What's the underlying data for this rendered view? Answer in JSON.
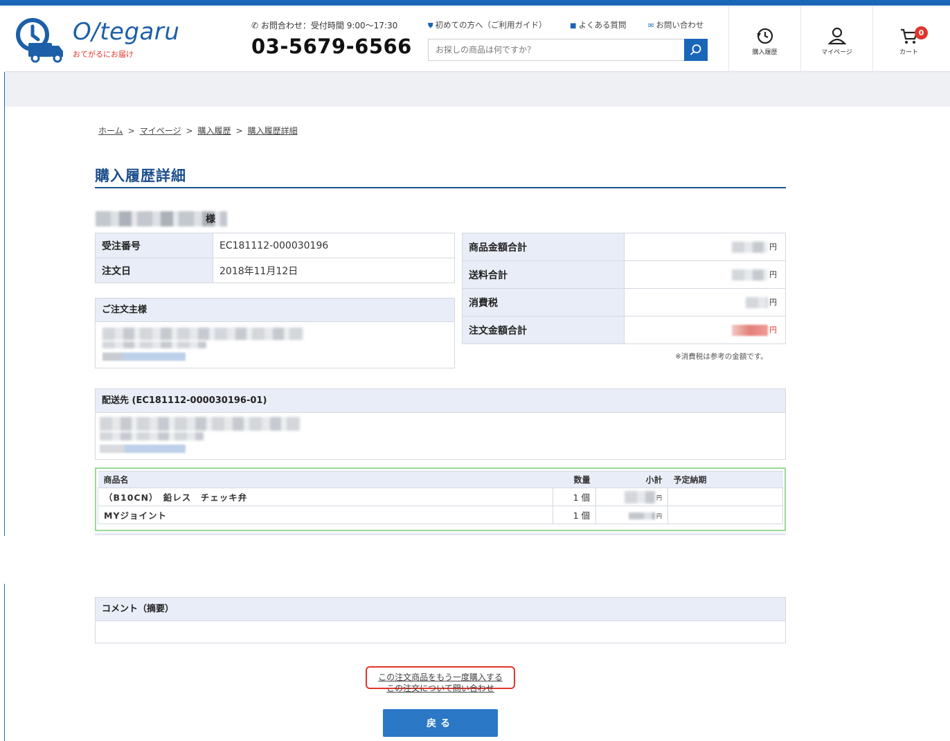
{
  "header": {
    "logo_text": "O/tegaru",
    "logo_tagline": "おてがるにお届け",
    "contact_label": "お問合わせ：受付時間 9:00〜17:30",
    "phone": "03-5679-6566",
    "links": [
      {
        "label": "初めての方へ（ご利用ガイド）",
        "icon": "shield-icon"
      },
      {
        "label": "よくある質問",
        "icon": "chat-icon"
      },
      {
        "label": "お問い合わせ",
        "icon": "mail-icon"
      }
    ],
    "search_placeholder": "お探しの商品は何ですか？",
    "icons": [
      {
        "label": "購入履歴",
        "icon": "history-icon"
      },
      {
        "label": "マイページ",
        "icon": "user-icon"
      },
      {
        "label": "カート",
        "icon": "cart-icon",
        "badge": "0"
      }
    ],
    "brand_color": "#1a66b8"
  },
  "breadcrumb": [
    {
      "label": "ホーム"
    },
    {
      "label": "マイページ"
    },
    {
      "label": "購入履歴"
    },
    {
      "label": "購入履歴詳細"
    }
  ],
  "breadcrumb_sep": ">",
  "page_title": "購入履歴詳細",
  "customer_suffix": "様",
  "order_info": {
    "order_no_label": "受注番号",
    "order_no": "EC181112-000030196",
    "order_date_label": "注文日",
    "order_date": "2018年11月12日"
  },
  "totals": {
    "product_total_label": "商品金額合計",
    "shipping_total_label": "送料合計",
    "tax_label": "消費税",
    "order_total_label": "注文金額合計",
    "currency": "円",
    "tax_note": "※消費税は参考の金額です。"
  },
  "orderer": {
    "title": "ご注文主様"
  },
  "shipping": {
    "title": "配送先 (EC181112-000030196-01)"
  },
  "items": {
    "headers": {
      "name": "商品名",
      "qty": "数量",
      "subtotal": "小計",
      "delivery": "予定納期"
    },
    "rows": [
      {
        "name": "（B10CN）　鉛レス　チェッキ弁",
        "qty": "1 個",
        "unit": "円"
      },
      {
        "name": "MYジョイント",
        "qty": "1 個",
        "unit": "円"
      }
    ]
  },
  "comment": {
    "title": "コメント（摘要）"
  },
  "actions": {
    "reorder": "この注文商品をもう一度購入する",
    "inquiry": "この注文について問い合わせ",
    "back": "戻る",
    "highlight_color": "#e0352b"
  }
}
